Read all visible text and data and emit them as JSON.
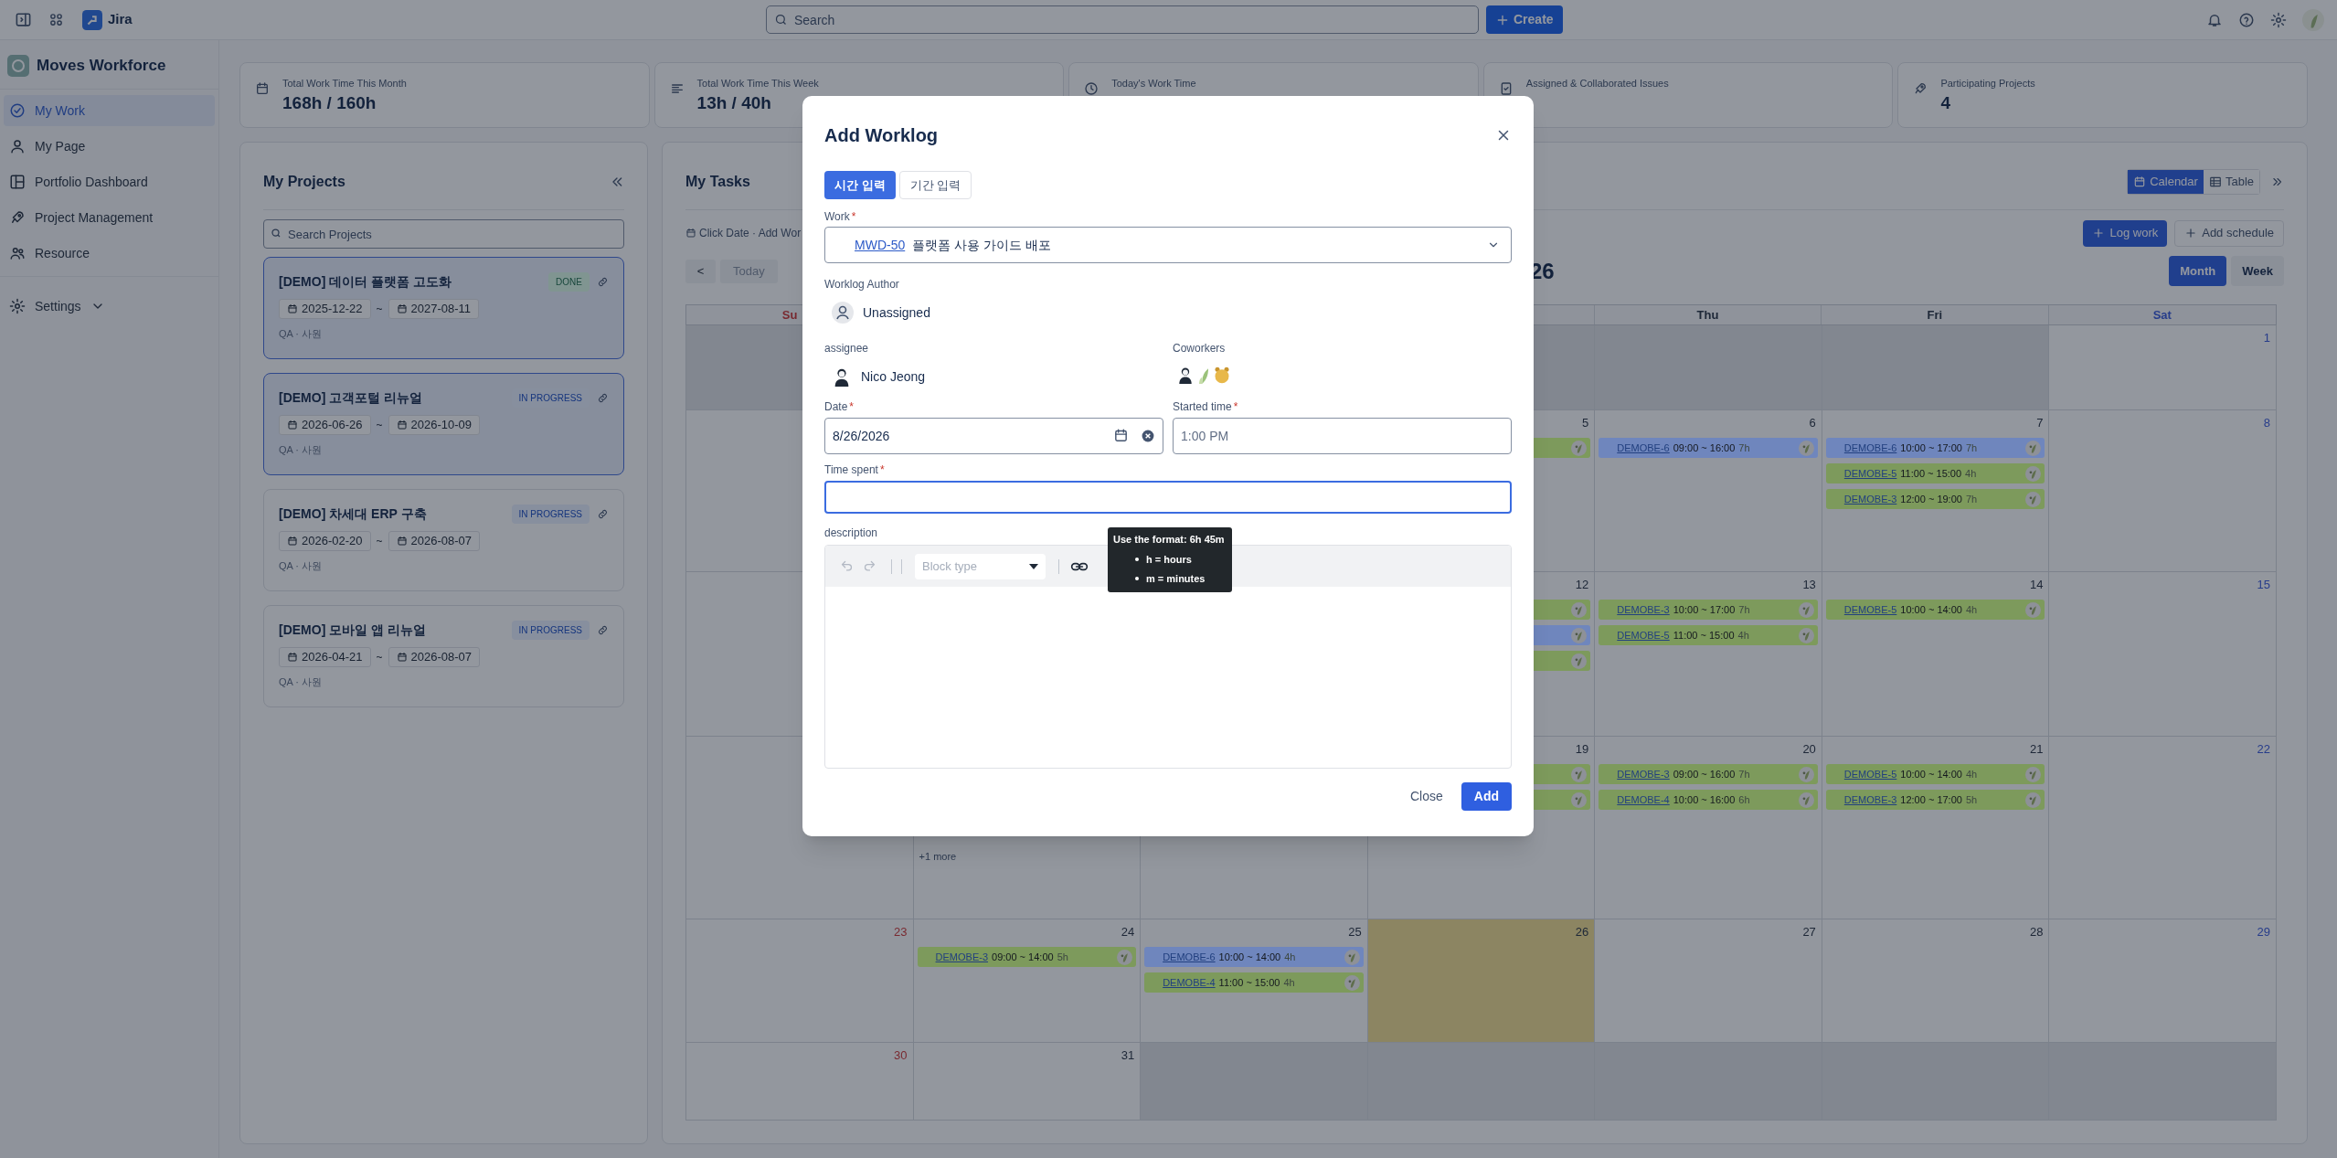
{
  "topbar": {
    "app_name": "Jira",
    "search": {
      "placeholder": "Search"
    },
    "create_button": "Create"
  },
  "sidebar": {
    "workspace": "Moves Workforce",
    "items": [
      {
        "label": "My Work",
        "selected": true
      },
      {
        "label": "My Page",
        "selected": false
      },
      {
        "label": "Portfolio Dashboard",
        "selected": false
      },
      {
        "label": "Project Management",
        "selected": false
      },
      {
        "label": "Resource",
        "selected": false
      }
    ],
    "settings": "Settings"
  },
  "stats": [
    {
      "label": "Total Work Time This Month",
      "value": "168h / 160h"
    },
    {
      "label": "Total Work Time This Week",
      "value": "13h / 40h"
    },
    {
      "label": "Today's Work Time"
    },
    {
      "label": "Assigned & Collaborated Issues"
    },
    {
      "label": "Participating Projects",
      "value": "4"
    }
  ],
  "projects": {
    "title": "My Projects",
    "search": {
      "placeholder": "Search Projects"
    },
    "items": [
      {
        "name": "[DEMO] 데이터 플랫폼 고도화",
        "status": "DONE",
        "kind": "done",
        "start": "2025-12-22",
        "separator": "~",
        "end": "2027-08-11",
        "role": "QA · 사원",
        "selected": true
      },
      {
        "name": "[DEMO] 고객포털 리뉴얼",
        "status": "IN PROGRESS",
        "kind": "progress",
        "start": "2026-06-26",
        "separator": "~",
        "end": "2026-10-09",
        "role": "QA · 사원",
        "selected": true
      },
      {
        "name": "[DEMO] 차세대 ERP 구축",
        "status": "IN PROGRESS",
        "kind": "progress",
        "start": "2026-02-20",
        "separator": "~",
        "end": "2026-08-07",
        "role": "QA · 사원",
        "selected": false
      },
      {
        "name": "[DEMO] 모바일 앱 리뉴얼",
        "status": "IN PROGRESS",
        "kind": "progress",
        "start": "2026-04-21",
        "separator": "~",
        "end": "2026-08-07",
        "role": "QA · 사원",
        "selected": false
      }
    ]
  },
  "tasks": {
    "title": "My Tasks",
    "views": [
      {
        "label": "Calendar",
        "selected": true
      },
      {
        "label": "Table",
        "selected": false
      }
    ],
    "hint": "Click Date · Add Wor",
    "log_work": "Log work",
    "add_schedule": "Add schedule",
    "prev": "<",
    "today": "Today",
    "month_title": "26",
    "ranges": [
      {
        "label": "Month",
        "selected": true
      },
      {
        "label": "Week",
        "selected": false
      }
    ],
    "weekdays": [
      {
        "label": "Su",
        "kind": "sunday"
      },
      {
        "label": "Thu",
        "kind": "weekday"
      },
      {
        "label": "Fri",
        "kind": "weekday"
      },
      {
        "label": "Sat",
        "kind": "saturday"
      }
    ],
    "weeks": [
      {
        "sun": {
          "outside": true,
          "today": false
        },
        "wed": {
          "outside": true,
          "today": false
        },
        "thu": {
          "outside": true,
          "today": false
        },
        "fri": {
          "outside": true,
          "today": false
        },
        "sat": {
          "number": "1",
          "kind": "saturday",
          "outside": false,
          "today": false
        }
      },
      {
        "sun": {
          "outside": false,
          "today": false
        },
        "wed": {
          "number": "5",
          "kind": "weekday",
          "outside": false,
          "today": false,
          "events": [
            {
              "color": "#7d9a5c"
            }
          ]
        },
        "thu": {
          "number": "6",
          "kind": "weekday",
          "outside": false,
          "today": false,
          "events": [
            {
              "key": "DEMOBE-6",
              "time": "09:00 ~ 16:00",
              "duration": "7h",
              "color": "#6f86bd"
            }
          ]
        },
        "fri": {
          "number": "7",
          "kind": "weekday",
          "outside": false,
          "today": false,
          "events": [
            {
              "key": "DEMOBE-6",
              "time": "10:00 ~ 17:00",
              "duration": "7h",
              "color": "#6f86bd"
            },
            {
              "key": "DEMOBE-5",
              "time": "11:00 ~ 15:00",
              "duration": "4h",
              "color": "#7d9a5c"
            },
            {
              "key": "DEMOBE-3",
              "time": "12:00 ~ 19:00",
              "duration": "7h",
              "color": "#7d9a5c"
            }
          ]
        },
        "sat": {
          "number": "8",
          "kind": "saturday",
          "outside": false,
          "today": false
        }
      },
      {
        "sun": {
          "outside": false,
          "today": false
        },
        "wed": {
          "number": "12",
          "kind": "weekday",
          "outside": false,
          "today": false,
          "events": [
            {
              "color": "#7d9a5c"
            },
            {
              "color": "#6f86bd"
            },
            {
              "color": "#7d9a5c"
            }
          ]
        },
        "thu": {
          "number": "13",
          "kind": "weekday",
          "outside": false,
          "today": false,
          "events": [
            {
              "key": "DEMOBE-3",
              "time": "10:00 ~ 17:00",
              "duration": "7h",
              "color": "#7d9a5c"
            },
            {
              "key": "DEMOBE-5",
              "time": "11:00 ~ 15:00",
              "duration": "4h",
              "color": "#7d9a5c"
            }
          ]
        },
        "fri": {
          "number": "14",
          "kind": "weekday",
          "outside": false,
          "today": false,
          "events": [
            {
              "key": "DEMOBE-5",
              "time": "10:00 ~ 14:00",
              "duration": "4h",
              "color": "#7d9a5c"
            }
          ]
        },
        "sat": {
          "number": "15",
          "kind": "saturday",
          "outside": false,
          "today": false
        }
      },
      {
        "sun": {
          "outside": false,
          "today": false
        },
        "mon": {
          "outside": false,
          "today": false,
          "more": "+1 more"
        },
        "tue": {
          "outside": false,
          "today": false
        },
        "wed": {
          "number": "19",
          "kind": "weekday",
          "outside": false,
          "today": false,
          "events": [
            {
              "color": "#7d9a5c"
            },
            {
              "color": "#7d9a5c"
            }
          ]
        },
        "thu": {
          "number": "20",
          "kind": "weekday",
          "outside": false,
          "today": false,
          "events": [
            {
              "key": "DEMOBE-3",
              "time": "09:00 ~ 16:00",
              "duration": "7h",
              "color": "#7d9a5c"
            },
            {
              "key": "DEMOBE-4",
              "time": "10:00 ~ 16:00",
              "duration": "6h",
              "color": "#7d9a5c"
            }
          ]
        },
        "fri": {
          "number": "21",
          "kind": "weekday",
          "outside": false,
          "today": false,
          "events": [
            {
              "key": "DEMOBE-5",
              "time": "10:00 ~ 14:00",
              "duration": "4h",
              "color": "#7d9a5c"
            },
            {
              "key": "DEMOBE-3",
              "time": "12:00 ~ 17:00",
              "duration": "5h",
              "color": "#7d9a5c"
            }
          ]
        },
        "sat": {
          "number": "22",
          "kind": "saturday",
          "outside": false,
          "today": false
        }
      },
      {
        "sun": {
          "number": "23",
          "kind": "sunday",
          "outside": false,
          "today": false
        },
        "mon": {
          "number": "24",
          "kind": "weekday",
          "outside": false,
          "today": false,
          "events": [
            {
              "key": "DEMOBE-3",
              "time": "09:00 ~ 14:00",
              "duration": "5h",
              "color": "#7d9a5c"
            }
          ]
        },
        "tue": {
          "number": "25",
          "kind": "weekday",
          "outside": false,
          "today": false,
          "events": [
            {
              "key": "DEMOBE-6",
              "time": "10:00 ~ 14:00",
              "duration": "4h",
              "color": "#6f86bd"
            },
            {
              "key": "DEMOBE-4",
              "time": "11:00 ~ 15:00",
              "duration": "4h",
              "color": "#7d9a5c"
            }
          ]
        },
        "wed": {
          "number": "26",
          "kind": "weekday",
          "outside": false,
          "today": true
        },
        "thu": {
          "number": "27",
          "kind": "weekday",
          "outside": false,
          "today": false
        },
        "fri": {
          "number": "28",
          "kind": "weekday",
          "outside": false,
          "today": false
        },
        "sat": {
          "number": "29",
          "kind": "saturday",
          "outside": false,
          "today": false
        }
      },
      {
        "sun": {
          "number": "30",
          "kind": "sunday",
          "outside": false,
          "today": false
        },
        "mon": {
          "number": "31",
          "kind": "weekday",
          "outside": false,
          "today": false
        },
        "tue": {
          "outside": true,
          "today": false
        },
        "wed": {
          "outside": true,
          "today": false
        },
        "thu": {
          "outside": true,
          "today": false
        },
        "fri": {
          "outside": true,
          "today": false
        },
        "sat": {
          "outside": true,
          "today": false
        }
      }
    ]
  },
  "modal": {
    "title": "Add Worklog",
    "tabs": [
      {
        "label": "시간 입력",
        "selected": true
      },
      {
        "label": "기간 입력",
        "selected": false
      }
    ],
    "work": {
      "label": "Work",
      "required_mark": "*",
      "issue_key": "MWD-50",
      "issue_title": "플랫폼 사용 가이드 배포"
    },
    "author": {
      "label": "Worklog Author",
      "name": "Unassigned"
    },
    "assignee": {
      "label": "assignee",
      "name": "Nico Jeong"
    },
    "coworkers": {
      "label": "Coworkers",
      "avatars": [
        {
          "kind": "person"
        },
        {
          "kind": "sprout"
        },
        {
          "kind": "bear"
        }
      ]
    },
    "date": {
      "label": "Date",
      "required_mark": "*",
      "value": "8/26/2026"
    },
    "start_time": {
      "label": "Started time",
      "required_mark": "*",
      "placeholder": "1:00 PM"
    },
    "time_spent": {
      "label": "Time spent",
      "required_mark": "*",
      "focused": true
    },
    "description": {
      "label": "description",
      "block_type": {
        "placeholder": "Block type"
      }
    },
    "tooltip": {
      "title": "Use the format: 6h 45m",
      "items": [
        "h = hours",
        "m = minutes"
      ]
    },
    "close": "Close",
    "add": "Add"
  }
}
